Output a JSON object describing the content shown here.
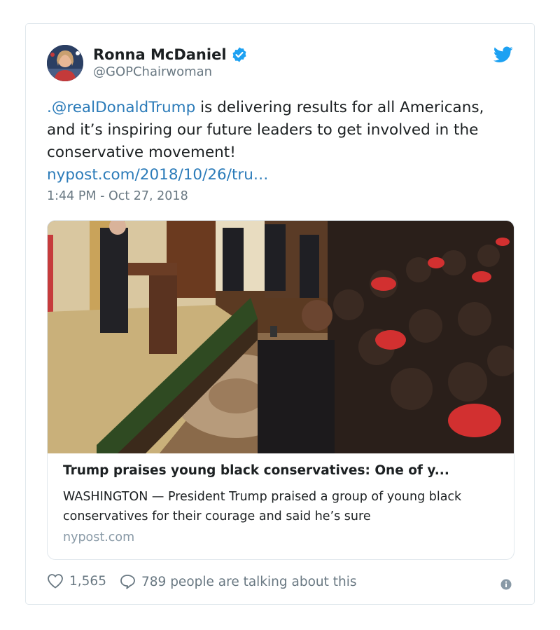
{
  "user": {
    "name": "Ronna McDaniel",
    "handle": "@GOPChairwoman",
    "verified_icon": "verified-badge-icon",
    "brand_color": "#1da1f2"
  },
  "tweet": {
    "mention": ".@realDonaldTrump",
    "body_text": " is delivering results for all Americans, and it’s inspiring our future leaders to get involved in the conservative movement!",
    "link": "nypost.com/2018/10/26/tru…",
    "timestamp": "1:44 PM - Oct 27, 2018",
    "link_color": "#2b7bb9"
  },
  "card": {
    "title": "Trump praises young black conservatives: One of y...",
    "description": "WASHINGTON — President Trump praised a group of young black conservatives for their courage and said he’s sure",
    "domain": "nypost.com"
  },
  "footer": {
    "likes": "1,565",
    "talking": "789 people are talking about this"
  }
}
